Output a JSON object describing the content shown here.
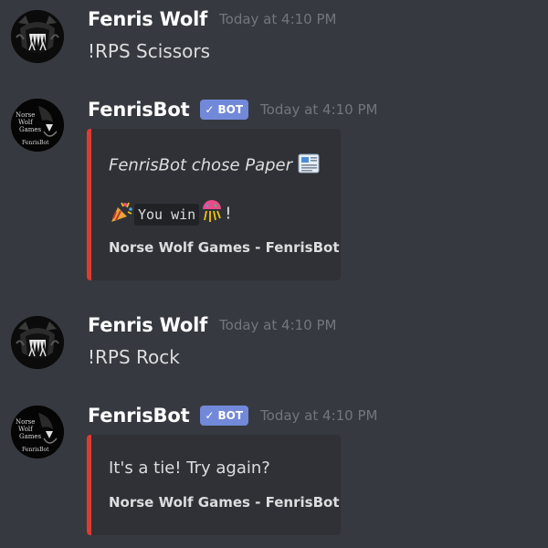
{
  "colors": {
    "background": "#36393f",
    "embed_background": "#2f3136",
    "embed_accent": "#e03a2f",
    "bot_tag": "#7289da",
    "username": "#ffffff",
    "timestamp": "#72767d",
    "text": "#dcddde"
  },
  "messages": [
    {
      "author": "Fenris Wolf",
      "timestamp": "Today at 4:10 PM",
      "avatar_icon": "wolf-avatar-icon",
      "text": "!RPS Scissors"
    },
    {
      "author": "FenrisBot",
      "bot_tag": "BOT",
      "timestamp": "Today at 4:10 PM",
      "avatar_icon": "norse-wolf-games-logo",
      "avatar_logo_text": [
        "Norse",
        "Wolf",
        "Games",
        "FenrisBot"
      ],
      "embed": {
        "line1": "FenrisBot chose Paper",
        "line1_emoji": "newspaper-icon",
        "line2_code": "You win",
        "line2_suffix": "!",
        "line2_emojis": [
          "party-popper-icon",
          "confetti-ball-icon"
        ],
        "footer": "Norse Wolf Games - FenrisBot"
      }
    },
    {
      "author": "Fenris Wolf",
      "timestamp": "Today at 4:10 PM",
      "avatar_icon": "wolf-avatar-icon",
      "text": "!RPS Rock"
    },
    {
      "author": "FenrisBot",
      "bot_tag": "BOT",
      "timestamp": "Today at 4:10 PM",
      "avatar_icon": "norse-wolf-games-logo",
      "avatar_logo_text": [
        "Norse",
        "Wolf",
        "Games",
        "FenrisBot"
      ],
      "embed": {
        "line1": "It's a tie! Try again?",
        "footer": "Norse Wolf Games - FenrisBot"
      }
    }
  ]
}
